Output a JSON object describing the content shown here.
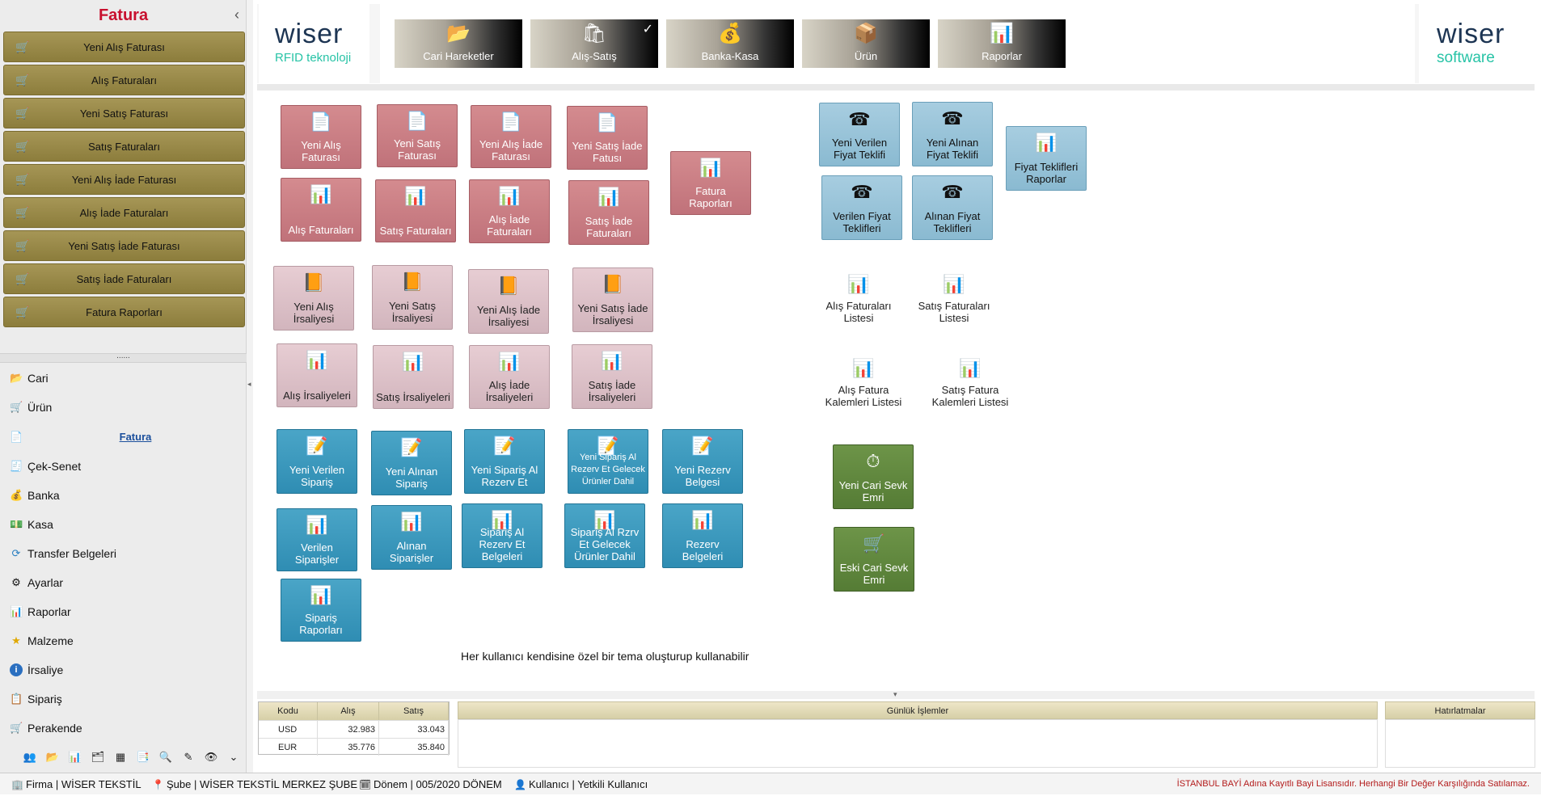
{
  "sidebar": {
    "title": "Fatura",
    "fatura_items": [
      "Yeni Alış Faturası",
      "Alış Faturaları",
      "Yeni Satış Faturası",
      "Satış Faturaları",
      "Yeni Alış İade Faturası",
      "Alış İade Faturaları",
      "Yeni Satış İade Faturası",
      "Satış İade Faturaları",
      "Fatura Raporları"
    ],
    "grip": "......",
    "nav": [
      {
        "label": "Cari",
        "icon": "folder-icon"
      },
      {
        "label": "Ürün",
        "icon": "cart-icon"
      },
      {
        "label": "Fatura",
        "icon": "document-icon"
      },
      {
        "label": "Çek-Senet",
        "icon": "cheque-icon"
      },
      {
        "label": "Banka",
        "icon": "coins-icon"
      },
      {
        "label": "Kasa",
        "icon": "cash-icon"
      },
      {
        "label": "Transfer Belgeleri",
        "icon": "transfer-icon"
      },
      {
        "label": "Ayarlar",
        "icon": "settings-icon"
      },
      {
        "label": "Raporlar",
        "icon": "chart-icon"
      },
      {
        "label": "Malzeme",
        "icon": "star-icon"
      },
      {
        "label": "İrsaliye",
        "icon": "info-icon"
      },
      {
        "label": "Sipariş",
        "icon": "order-icon"
      },
      {
        "label": "Perakende",
        "icon": "cart-icon"
      }
    ]
  },
  "header": {
    "logo_left": {
      "word": "wiser",
      "sub": "RFID teknoloji"
    },
    "logo_right": {
      "word": "wiser",
      "sub": "software"
    },
    "buttons": [
      "Cari Hareketler",
      "Alış-Satış",
      "Banka-Kasa",
      "Ürün",
      "Raporlar"
    ]
  },
  "tiles": {
    "fatura": [
      "Yeni Alış Faturası",
      "Yeni Satış Faturası",
      "Yeni Alış İade Faturası",
      "Yeni Satış İade Fatusı",
      "Fatura Raporları",
      "Alış Faturaları",
      "Satış Faturaları",
      "Alış İade Faturaları",
      "Satış İade Faturaları"
    ],
    "irsaliye": [
      "Yeni Alış İrsaliyesi",
      "Yeni Satış İrsaliyesi",
      "Yeni Alış İade İrsaliyesi",
      "Yeni Satış İade İrsaliyesi",
      "Alış İrsaliyeleri",
      "Satış İrsaliyeleri",
      "Alış İade İrsaliyeleri",
      "Satış İade İrsaliyeleri"
    ],
    "siparis": [
      "Yeni Verilen Sipariş",
      "Yeni Alınan Sipariş",
      "Yeni Sipariş Al Rezerv Et",
      "Yeni Sipariş Al Rezerv Et Gelecek Ürünler Dahil",
      "Yeni Rezerv Belgesi",
      "Verilen Siparişler",
      "Alınan Siparişler",
      "Sipariş Al Rezerv Et Belgeleri",
      "Sipariş Al Rzrv Et Gelecek Ürünler Dahil",
      "Rezerv Belgeleri",
      "Sipariş Raporları"
    ],
    "teklif": [
      "Yeni Verilen Fiyat Teklifi",
      "Yeni Alınan Fiyat Teklifi",
      "Fiyat Teklifleri Raporlar",
      "Verilen Fiyat Teklifleri",
      "Alınan Fiyat Teklifleri"
    ],
    "listeler": [
      "Alış Faturaları Listesi",
      "Satış Faturaları Listesi",
      "Alış Fatura Kalemleri Listesi",
      "Satış Fatura Kalemleri Listesi"
    ],
    "sevk": [
      "Yeni Cari Sevk Emri",
      "Eski Cari Sevk Emri"
    ]
  },
  "theme_note": "Her kullanıcı kendisine özel bir tema oluşturup kullanabilir",
  "currency": {
    "headers": [
      "Kodu",
      "Alış",
      "Satış"
    ],
    "rows": [
      [
        "USD",
        "32.983",
        "33.043"
      ],
      [
        "EUR",
        "35.776",
        "35.840"
      ]
    ]
  },
  "daily": {
    "title": "Günlük İşlemler"
  },
  "reminders": {
    "title": "Hatırlatmalar"
  },
  "status": {
    "firma": "Firma | WİSER TEKSTİL",
    "sube": "Şube | WİSER TEKSTİL MERKEZ ŞUBE",
    "donem": "Dönem | 005/2020 DÖNEM",
    "kullanici": "Kullanıcı | Yetkili Kullanıcı",
    "license": "İSTANBUL BAYİ Adına Kayıtlı Bayi Lisansıdır. Herhangi Bir Değer Karşılığında Satılamaz."
  },
  "colors": {
    "accent_red": "#c8102e",
    "fatura_item": "#9c8c4a",
    "logo_teal": "#27c3a6"
  }
}
